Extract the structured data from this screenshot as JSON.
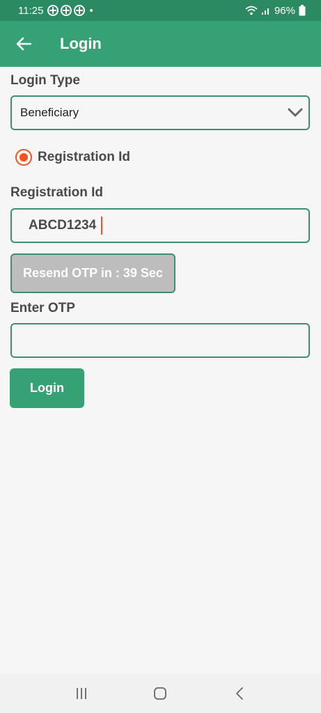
{
  "status": {
    "time": "11:25",
    "battery": "96%",
    "dot": "•"
  },
  "app_bar": {
    "title": "Login"
  },
  "form": {
    "login_type_label": "Login Type",
    "login_type_value": "Beneficiary",
    "radio_label": "Registration Id",
    "reg_id_label": "Registration Id",
    "reg_id_value": "ABCD1234",
    "resend_label": "Resend OTP in : 39 Sec",
    "otp_label": "Enter OTP",
    "otp_value": "",
    "login_button": "Login"
  },
  "colors": {
    "primary": "#36a174",
    "status_bar": "#2c8a63",
    "accent": "#f4511e",
    "border": "#3a9070",
    "disabled": "#bdbdbd"
  },
  "icons": {
    "back": "arrow-left-icon",
    "dropdown": "chevron-down-icon",
    "nav_recent": "recent-apps-icon",
    "nav_home": "home-icon",
    "nav_back": "back-icon"
  }
}
